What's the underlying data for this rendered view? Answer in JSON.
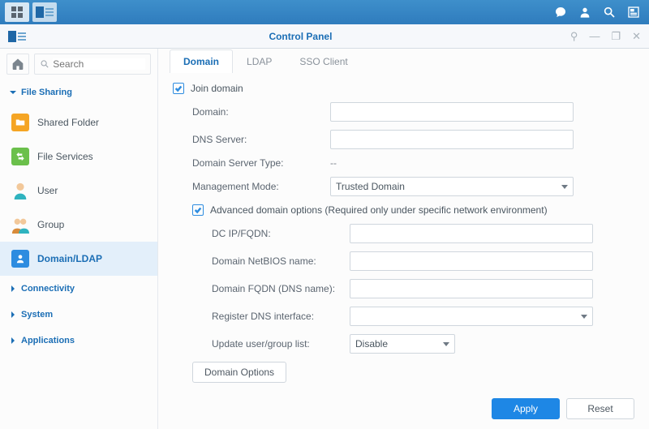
{
  "window": {
    "title": "Control Panel"
  },
  "search": {
    "placeholder": "Search"
  },
  "sidebar": {
    "groups": {
      "file_sharing": "File Sharing",
      "connectivity": "Connectivity",
      "system": "System",
      "applications": "Applications"
    },
    "items": {
      "shared_folder": "Shared Folder",
      "file_services": "File Services",
      "user": "User",
      "group": "Group",
      "domain_ldap": "Domain/LDAP"
    }
  },
  "tabs": {
    "domain": "Domain",
    "ldap": "LDAP",
    "sso": "SSO Client"
  },
  "form": {
    "join_domain": "Join domain",
    "domain_label": "Domain:",
    "domain_value": "",
    "dns_label": "DNS Server:",
    "dns_value": "",
    "server_type_label": "Domain Server Type:",
    "server_type_value": "--",
    "mgmt_label": "Management Mode:",
    "mgmt_value": "Trusted Domain",
    "advanced": "Advanced domain options (Required only under specific network environment)",
    "dc_label": "DC IP/FQDN:",
    "dc_value": "",
    "netbios_label": "Domain NetBIOS name:",
    "netbios_value": "",
    "fqdn_label": "Domain FQDN (DNS name):",
    "fqdn_value": "",
    "register_dns_label": "Register DNS interface:",
    "register_dns_value": "",
    "update_list_label": "Update user/group list:",
    "update_list_value": "Disable",
    "domain_options_btn": "Domain Options"
  },
  "buttons": {
    "apply": "Apply",
    "reset": "Reset"
  }
}
